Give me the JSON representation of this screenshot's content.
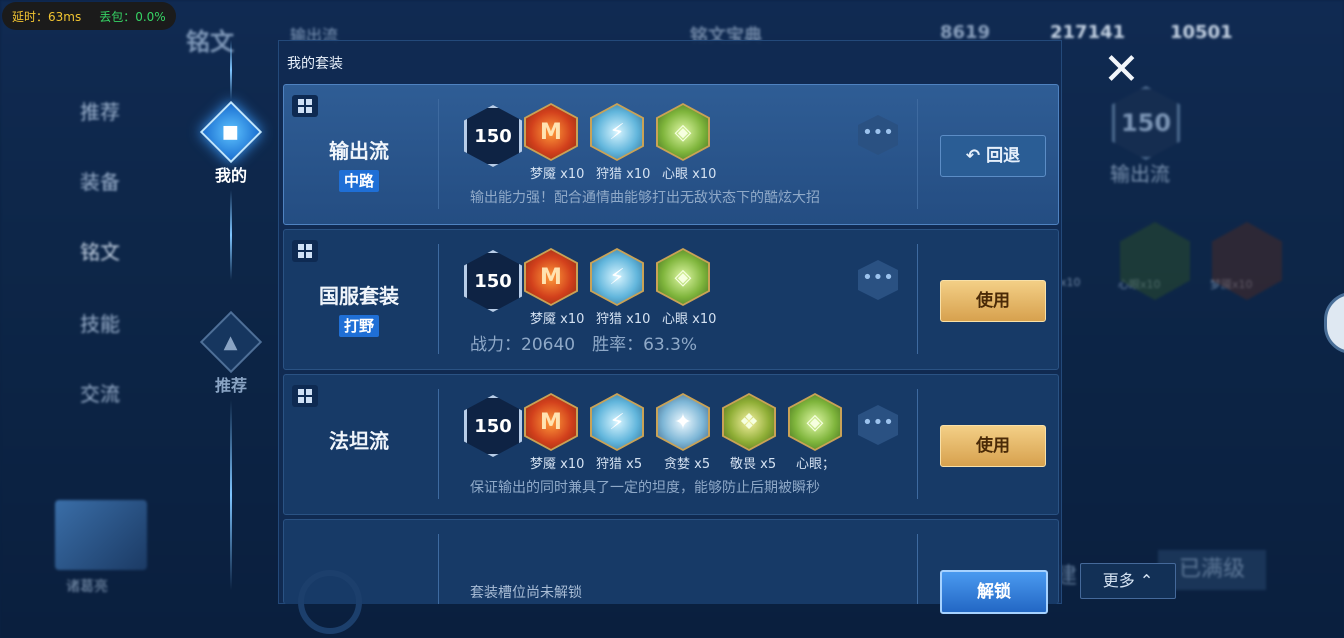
{
  "status": {
    "latency": "延时：63ms",
    "loss": "丢包：0.0%"
  },
  "background": {
    "title": "铭文",
    "level_badge": "150",
    "current_set": "输出流",
    "dictionary": "铭文宝典",
    "currency1": "8619",
    "currency2": "217141",
    "currency3": "10501",
    "menu": [
      "推荐",
      "装备",
      "铭文",
      "技能",
      "交流"
    ],
    "right_level": "150",
    "right_set": "输出流",
    "right_runes": [
      "x10",
      "心眼x10",
      "梦魇x10"
    ],
    "hero_name": "诸葛亮",
    "maxed": "已满级",
    "build": "建"
  },
  "nav": {
    "mine_label": "我的",
    "recommend_label": "推荐"
  },
  "modal": {
    "title": "我的套装",
    "cards": [
      {
        "name": "输出流",
        "tag": "中路",
        "level": "150",
        "runes": [
          {
            "label": "梦魇 x10",
            "icon": "crimson-rune-icon"
          },
          {
            "label": "狩猎 x10",
            "icon": "azure-rune-icon"
          },
          {
            "label": "心眼 x10",
            "icon": "verdant-rune-icon"
          }
        ],
        "desc": "输出能力强！配合通情曲能够打出无敌状态下的酷炫大招",
        "button": "回退"
      },
      {
        "name": "国服套装",
        "tag": "打野",
        "level": "150",
        "runes": [
          {
            "label": "梦魇 x10",
            "icon": "crimson-rune-icon"
          },
          {
            "label": "狩猎 x10",
            "icon": "azure-rune-icon"
          },
          {
            "label": "心眼 x10",
            "icon": "verdant-rune-icon"
          }
        ],
        "desc": "战力：20640　胜率：63.3%",
        "button": "使用"
      },
      {
        "name": "法坦流",
        "tag": "",
        "level": "150",
        "runes": [
          {
            "label": "梦魇 x10",
            "icon": "crimson-rune-icon"
          },
          {
            "label": "狩猎 x5",
            "icon": "azure-rune-icon"
          },
          {
            "label": "贪婪 x5",
            "icon": "azure-rune-icon"
          },
          {
            "label": "敬畏 x5",
            "icon": "verdant-rune-icon"
          },
          {
            "label": "心眼；",
            "icon": "verdant-rune-icon"
          }
        ],
        "desc": "保证输出的同时兼具了一定的坦度，能够防止后期被瞬秒",
        "button": "使用"
      },
      {
        "locked_text": "套装槽位尚未解锁",
        "button": "解锁"
      }
    ]
  },
  "right": {
    "close": "✕",
    "more": "更多"
  }
}
